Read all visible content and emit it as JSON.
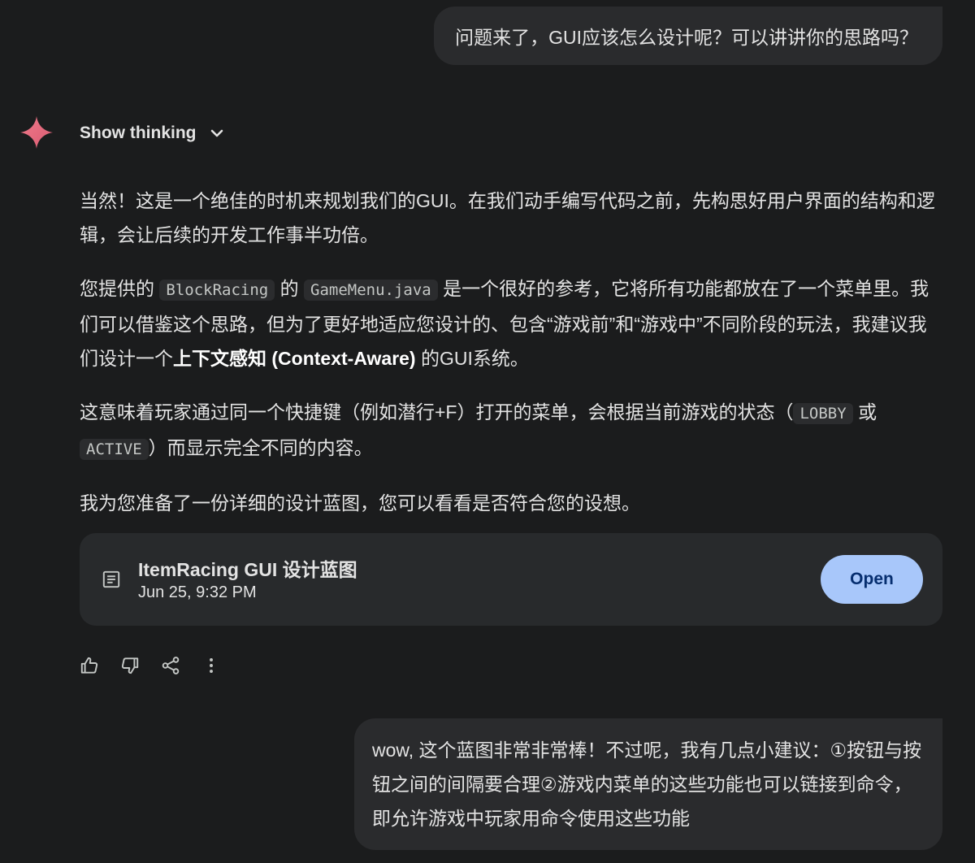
{
  "conversation": {
    "user_message_1": "问题来了，GUI应该怎么设计呢？可以讲讲你的思路吗？",
    "show_thinking_label": "Show thinking",
    "response": {
      "p1": "当然！这是一个绝佳的时机来规划我们的GUI。在我们动手编写代码之前，先构思好用户界面的结构和逻辑，会让后续的开发工作事半功倍。",
      "p2_a": "您提供的",
      "p2_code1": "BlockRacing",
      "p2_b": "的",
      "p2_code2": "GameMenu.java",
      "p2_c": "是一个很好的参考，它将所有功能都放在了一个菜单里。我们可以借鉴这个思路，但为了更好地适应您设计的、包含“游戏前”和“游戏中”不同阶段的玩法，我建议我们设计一个",
      "p2_bold": "上下文感知 (Context-Aware)",
      "p2_d": "的GUI系统。",
      "p3_a": "这意味着玩家通过同一个快捷键（例如潜行+F）打开的菜单，会根据当前游戏的状态（",
      "p3_code1": "LOBBY",
      "p3_b": "或",
      "p3_code2": "ACTIVE",
      "p3_c": "）而显示完全不同的内容。",
      "p4": "我为您准备了一份详细的设计蓝图，您可以看看是否符合您的设想。"
    },
    "document_card": {
      "title": "ItemRacing GUI 设计蓝图",
      "date": "Jun 25, 9:32 PM",
      "open_label": "Open"
    },
    "user_message_2": "wow, 这个蓝图非常非常棒！不过呢，我有几点小建议：①按钮与按钮之间的间隔要合理②游戏内菜单的这些功能也可以链接到命令，即允许游戏中玩家用命令使用这些功能"
  },
  "icons": {
    "spark": "gemini-spark-icon",
    "chevron": "chevron-down-icon",
    "doc": "document-icon",
    "thumbs_up": "thumbs-up-icon",
    "thumbs_down": "thumbs-down-icon",
    "share": "share-icon",
    "more": "more-vert-icon"
  },
  "colors": {
    "background": "#1b1c1d",
    "bubble": "#2a2b2d",
    "card": "#282a2c",
    "accent_button": "#a8c7fa",
    "accent_button_text": "#062e6f",
    "text": "#e3e3e3"
  }
}
